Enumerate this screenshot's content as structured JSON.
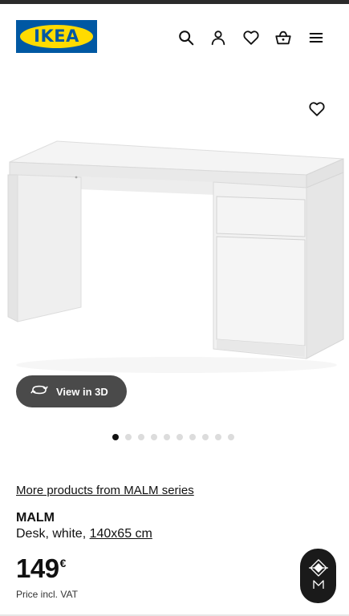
{
  "brand": {
    "logo_text": "IKEA",
    "colors": {
      "blue": "#0058a3",
      "yellow": "#ffdb00"
    }
  },
  "header": {
    "icons": [
      "search-icon",
      "profile-icon",
      "heart-icon",
      "shopping-bag-icon",
      "menu-icon"
    ]
  },
  "gallery": {
    "favorite_icon": "heart-icon",
    "view_3d_label": "View in 3D",
    "view_3d_icon": "rotate-3d-icon",
    "dot_count": 10,
    "active_dot": 0
  },
  "product": {
    "series_link": "More products from MALM series",
    "name": "MALM",
    "description_prefix": "Desk, white, ",
    "dimensions": "140x65 cm",
    "price_amount": "149",
    "currency": "€",
    "price_note": "Price incl. VAT"
  },
  "assistant": {
    "icon": "assistant-icon"
  }
}
